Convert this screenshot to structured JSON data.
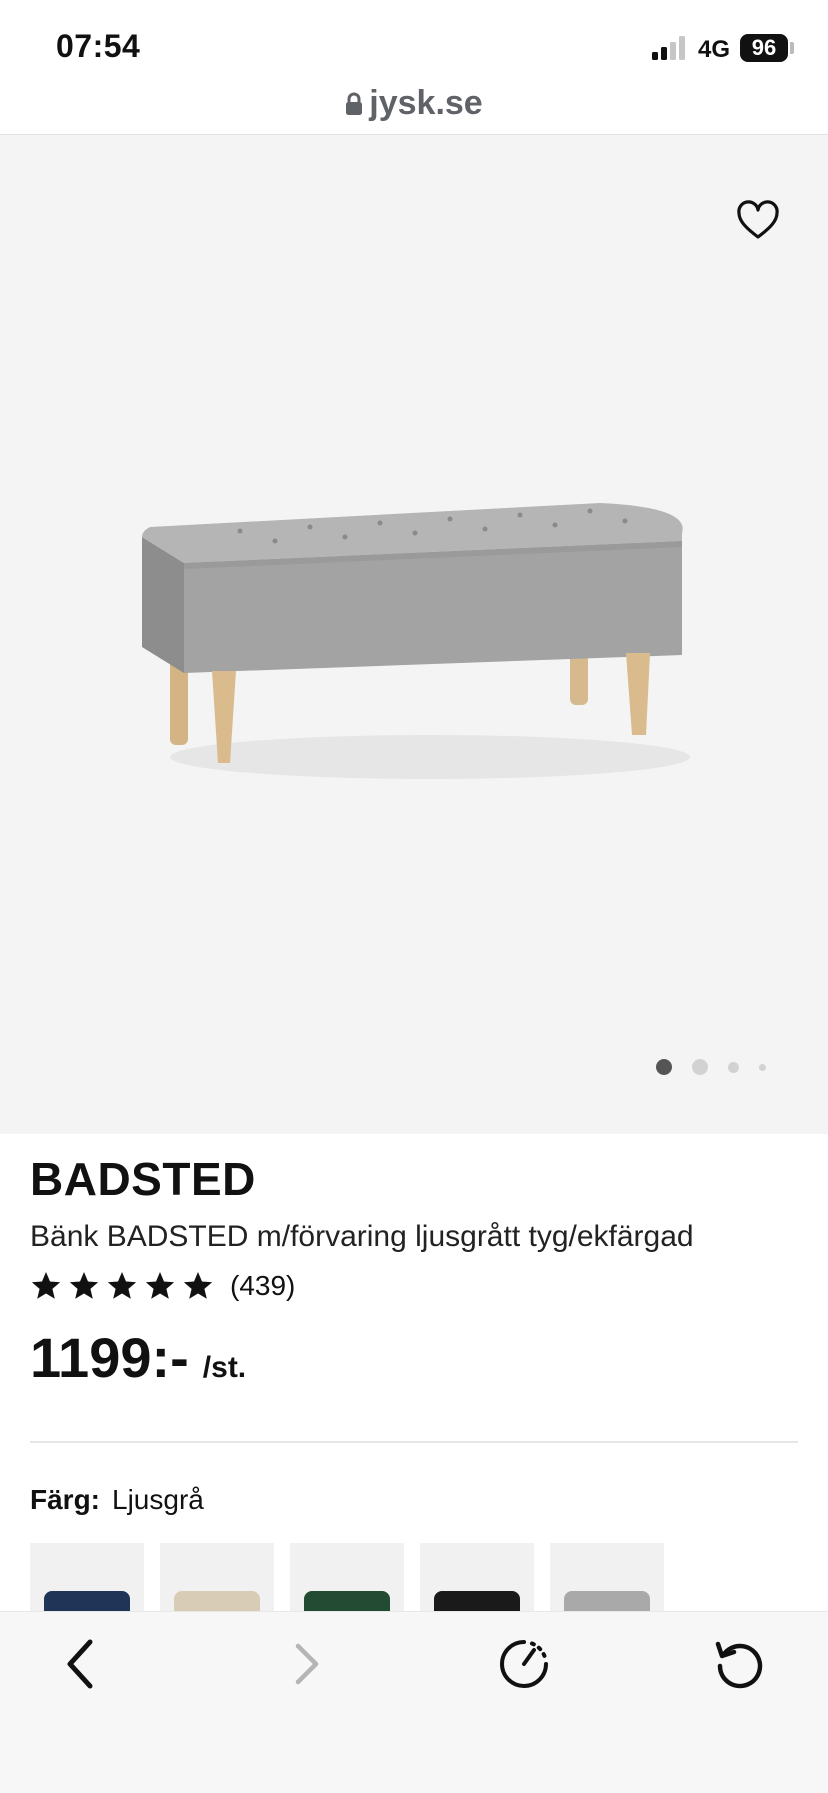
{
  "status_bar": {
    "time": "07:54",
    "network": "4G",
    "battery": "96"
  },
  "browser": {
    "url": "jysk.se"
  },
  "gallery": {
    "favorite_icon": "heart-outline-icon",
    "dots_total": 4,
    "active_dot": 1
  },
  "product": {
    "brand": "BADSTED",
    "name": "Bänk BADSTED m/förvaring ljusgrått tyg/ekfärgad",
    "stars": 5,
    "rating_count": "(439)",
    "price": "1199:-",
    "unit": "/st."
  },
  "color": {
    "label": "Färg:",
    "value": "Ljusgrå",
    "swatches": [
      {
        "name": "Blå",
        "hex": "#1f3457"
      },
      {
        "name": "Beige",
        "hex": "#d8ccb7"
      },
      {
        "name": "Grön",
        "hex": "#234a32"
      },
      {
        "name": "Svart",
        "hex": "#1a1a1a"
      },
      {
        "name": "Ljusgrå",
        "hex": "#a9a9a9"
      }
    ]
  },
  "toolbar": {
    "back_icon": "chevron-left-icon",
    "forward_icon": "chevron-right-icon",
    "speed_icon": "speedometer-icon",
    "reload_icon": "reload-icon"
  }
}
